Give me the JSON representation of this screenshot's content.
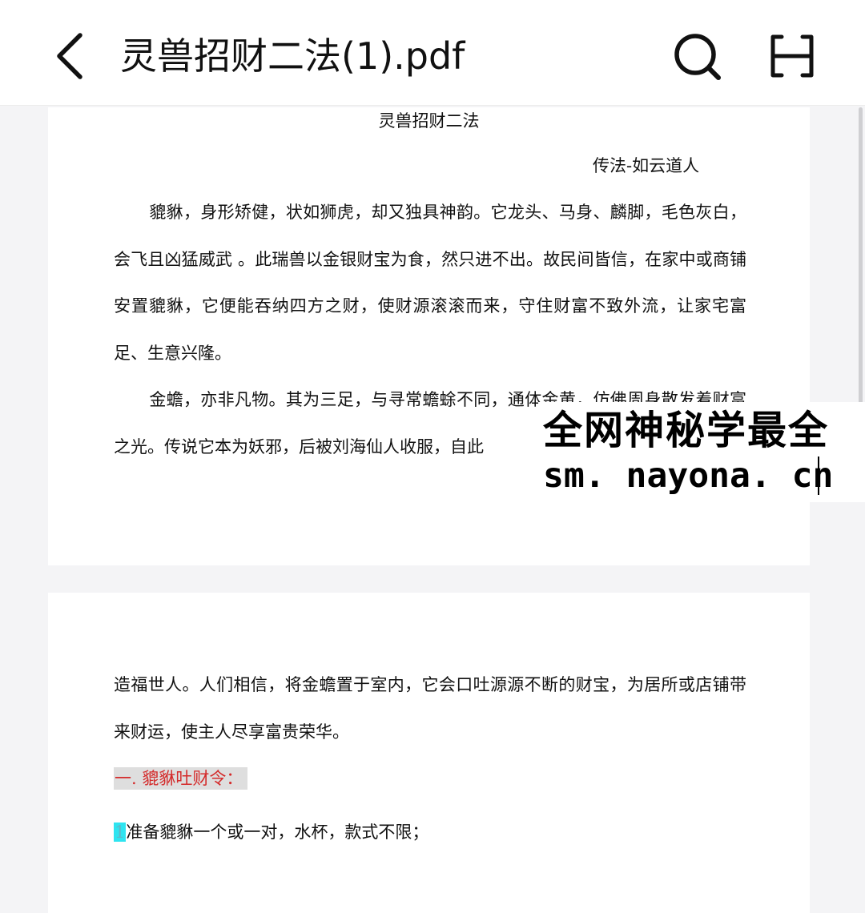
{
  "header": {
    "file_title": "灵兽招财二法(1).pdf",
    "icons": {
      "back": "chevron-left-icon",
      "search": "search-icon",
      "menu": "hamburger-menu-icon"
    }
  },
  "page1": {
    "title": "灵兽招财二法",
    "author": "传法-如云道人",
    "paragraph1": "貔貅，身形矫健，状如狮虎，却又独具神韵。它龙头、马身、麟脚，毛色灰白，会飞且凶猛威武 。此瑞兽以金银财宝为食，然只进不出。故民间皆信，在家中或商铺安置貔貅，它便能吞纳四方之财，使财源滚滚而来，守住财富不致外流，让家宅富足、生意兴隆。",
    "paragraph2": "金蟾，亦非凡物。其为三足，与寻常蟾蜍不同，通体金黄，仿佛周身散发着财富之光。传说它本为妖邪，后被刘海仙人收服，自此"
  },
  "page2": {
    "paragraph1": "造福世人。人们相信，将金蟾置于室内，它会口吐源源不断的财宝，为居所或店铺带来财运，使主人尽享富贵荣华。",
    "section_heading": "一. 貔貅吐财令：",
    "step_number": "1",
    "step_text": "准备貔貅一个或一对，水杯，款式不限；"
  },
  "watermark": {
    "line1": "全网神秘学最全",
    "line2": "sm. nayona. cn"
  },
  "colors": {
    "heading_red": "#d42a2a",
    "heading_bg": "#dedede",
    "step_highlight": "#2ee4f0"
  }
}
